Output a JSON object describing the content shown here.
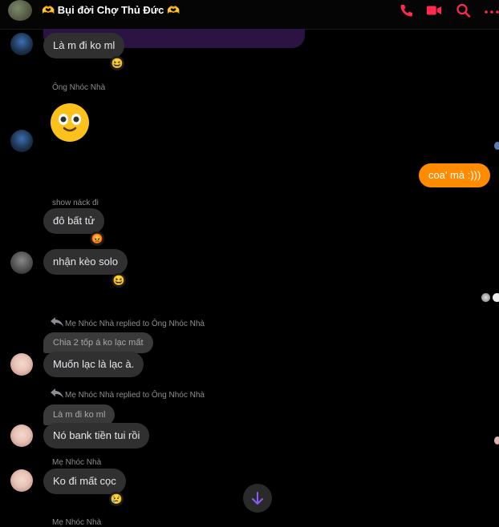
{
  "header": {
    "title": "🫶 Bụi đời Chợ Thủ Đức 🫶",
    "icons": [
      "phone-icon",
      "video-call-icon",
      "search-icon",
      "more-icon"
    ],
    "accent": "#ff2b4f"
  },
  "messages": {
    "m1": "Là m đi ko ml",
    "m1_react": "😆",
    "sender_ong": "Ông Nhóc Nhà",
    "own": "coa' mà :)))",
    "show_nack": "show náck đi",
    "m2": "đô bất tử",
    "m2_react": "😡",
    "m3": "nhận kèo solo",
    "m3_react": "😆",
    "reply1_label": "Mẹ Nhóc Nhà replied to Ông Nhóc Nhà",
    "reply1_quote": "Chia 2 tốp á ko lạc mất",
    "m4": "Muốn lạc là lạc à.",
    "reply2_label": "Mẹ Nhóc Nhà replied to Ông Nhóc Nhà",
    "reply2_quote": "Là m đi ko ml",
    "m5": "Nó bank tiền tui rồi",
    "sender_me": "Mẹ Nhóc Nhà",
    "m6": "Ko đi mất cọc",
    "m6_react": "😢",
    "sender_me_2": "Mẹ Nhóc Nhà"
  },
  "colors": {
    "own_bubble": "#ff8c00",
    "bubble": "#303030",
    "fab_arrow": "#8a5cf6"
  }
}
